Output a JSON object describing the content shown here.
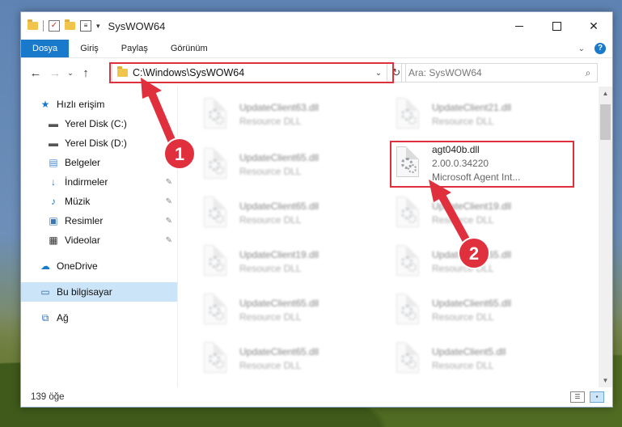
{
  "window": {
    "title": "SysWOW64",
    "controls": {
      "minimize": "",
      "maximize": "",
      "close": "✕"
    }
  },
  "ribbon": {
    "tabs": [
      "Dosya",
      "Giriş",
      "Paylaş",
      "Görünüm"
    ],
    "help": "?"
  },
  "navigation": {
    "address": "C:\\Windows\\SysWOW64",
    "search_placeholder": "Ara: SysWOW64"
  },
  "sidebar": {
    "quick_access": "Hızlı erişim",
    "items": [
      {
        "label": "Yerel Disk (C:)",
        "icon": "drive-icon",
        "pinned": false
      },
      {
        "label": "Yerel Disk (D:)",
        "icon": "drive-icon",
        "pinned": false
      },
      {
        "label": "Belgeler",
        "icon": "documents-icon",
        "pinned": true
      },
      {
        "label": "İndirmeler",
        "icon": "download-icon",
        "pinned": true
      },
      {
        "label": "Müzik",
        "icon": "music-icon",
        "pinned": true
      },
      {
        "label": "Resimler",
        "icon": "pictures-icon",
        "pinned": true
      },
      {
        "label": "Videolar",
        "icon": "video-icon",
        "pinned": true
      }
    ],
    "onedrive": "OneDrive",
    "this_pc": "Bu bilgisayar",
    "network": "Ağ"
  },
  "files": {
    "left_column": [
      {
        "name": "UpdateClient63.dll",
        "type": "Resource DLL"
      },
      {
        "name": "UpdateClient65.dll",
        "type": "Resource DLL"
      },
      {
        "name": "UpdateClient65.dll",
        "type": "Resource DLL"
      },
      {
        "name": "UpdateClient19.dll",
        "type": "Resource DLL"
      },
      {
        "name": "UpdateClient65.dll",
        "type": "Resource DLL"
      },
      {
        "name": "UpdateClient65.dll",
        "type": "Resource DLL"
      }
    ],
    "right_column": [
      {
        "name": "UpdateClient21.dll",
        "type": "Resource DLL"
      },
      {
        "name": "UpdateClient19.dll",
        "type": "Resource DLL"
      },
      {
        "name": "UpdateClient65.dll",
        "type": "Resource DLL"
      },
      {
        "name": "UpdateClient65.dll",
        "type": "Resource DLL"
      },
      {
        "name": "UpdateClient5.dll",
        "type": "Resource DLL"
      }
    ],
    "highlighted": {
      "name": "agt040b.dll",
      "version": "2.00.0.34220",
      "description": "Microsoft Agent Int..."
    }
  },
  "status": {
    "count": "139 öğe"
  },
  "callouts": [
    "1",
    "2"
  ],
  "colors": {
    "accent": "#1979ca",
    "annotation": "#e0303e"
  }
}
